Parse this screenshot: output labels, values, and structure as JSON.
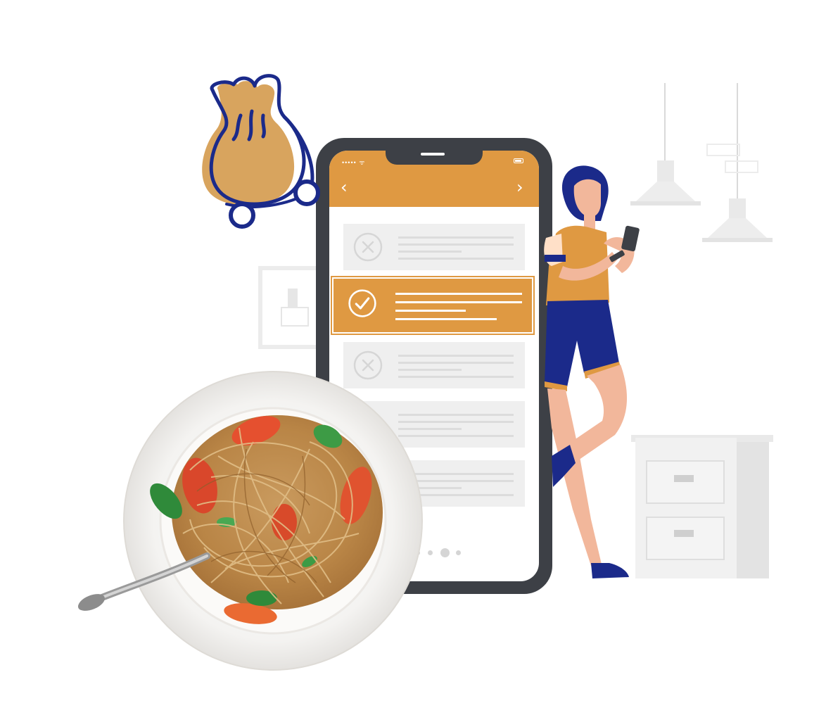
{
  "illustration": {
    "phone": {
      "status_bar": {
        "signal": "••••• ᯤ"
      },
      "header": {
        "back_icon": "chevron-left-icon",
        "forward_icon": "chevron-right-icon",
        "back": "‹",
        "forward": "›",
        "color": "#df9942"
      },
      "list_rows": [
        {
          "state": "rejected",
          "icon": "x-circle-icon"
        },
        {
          "state": "selected",
          "icon": "check-circle-icon"
        },
        {
          "state": "rejected",
          "icon": "x-circle-icon"
        },
        {
          "state": "rejected",
          "icon": "x-circle-icon"
        },
        {
          "state": "rejected",
          "icon": "x-circle-icon"
        }
      ],
      "pagination": {
        "count": 5,
        "active": 2
      }
    },
    "colors": {
      "accent": "#df9942",
      "navy": "#1b2a8a",
      "phone_body": "#3d4046",
      "skin": "#f2b79b"
    }
  }
}
